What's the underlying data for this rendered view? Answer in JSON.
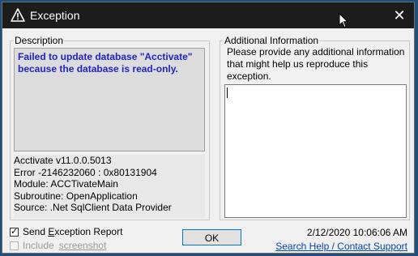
{
  "window": {
    "title": "Exception",
    "close_glyph": "✕",
    "title_icon": "warning-icon"
  },
  "description": {
    "group_label": "Description",
    "message": "Failed to update database \"Acctivate\" because the database is read-only.",
    "details": [
      "Acctivate v11.0.0.5013",
      "Error -2146232060 : 0x80131904",
      "Module: ACCTivateMain",
      "Subroutine: OpenApplication",
      "Source: .Net SqlClient Data Provider"
    ]
  },
  "additional_info": {
    "group_label": "Additional Information",
    "prompt": "Please provide any additional information that might help us reproduce this exception.",
    "value": ""
  },
  "options": {
    "send_report": {
      "label_pre": "Send ",
      "label_ul": "E",
      "label_post": "xception Report",
      "checked": true,
      "check_glyph": "✓"
    },
    "include_screenshot": {
      "label": "Include",
      "link_label": "screenshot",
      "checked": false
    }
  },
  "ok_button": {
    "label": "OK"
  },
  "timestamp": "2/12/2020 10:06:06 AM",
  "help_link": "Search Help / Contact Support",
  "colors": {
    "title_bar": "#1c1c1c",
    "message_text": "#2222c8",
    "link": "#0645ad",
    "ok_border": "#0078d7"
  }
}
